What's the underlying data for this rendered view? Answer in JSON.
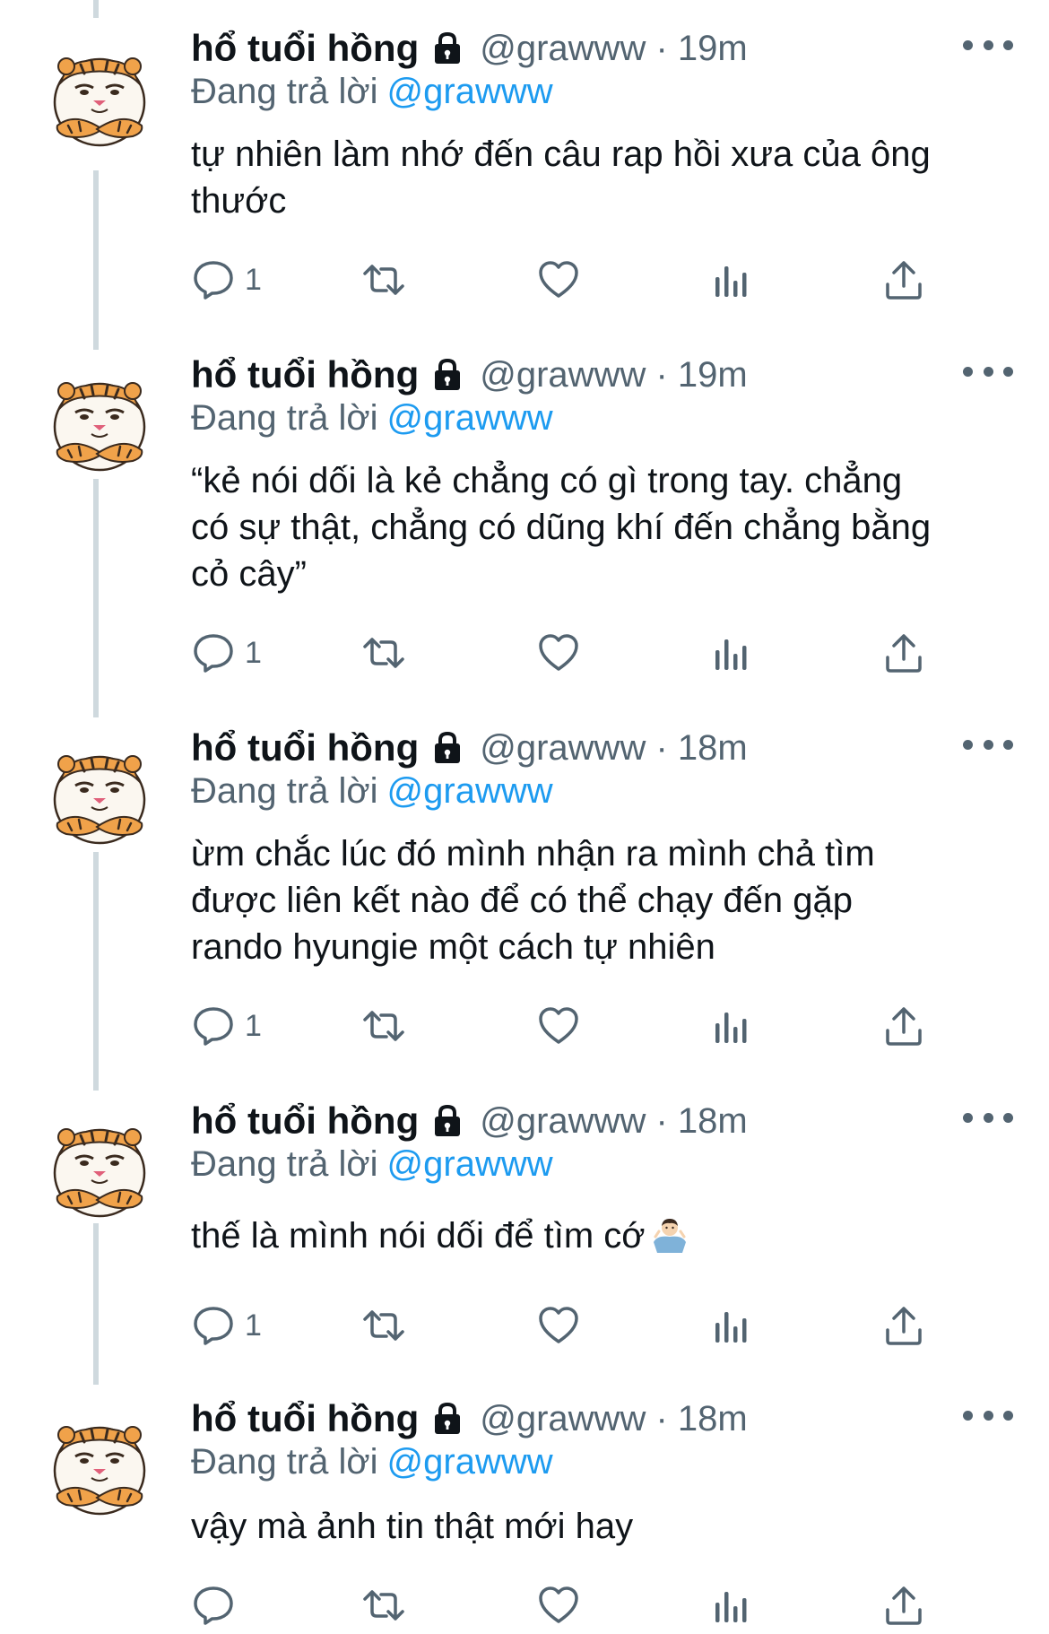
{
  "tweets": [
    {
      "name": "hổ tuổi hồng",
      "handle": "@grawww",
      "time": "19m",
      "meta": "@grawww · 19m",
      "replying_label": "Đang trả lời",
      "replying_to": "@grawww",
      "lines": [
        "tự nhiên làm nhớ đến câu rap hồi xưa của ông",
        "thước"
      ],
      "reply_count": "1"
    },
    {
      "name": "hổ tuổi hồng",
      "handle": "@grawww",
      "time": "19m",
      "meta": "@grawww · 19m",
      "replying_label": "Đang trả lời",
      "replying_to": "@grawww",
      "lines": [
        "“kẻ nói dối là kẻ chẳng có gì trong tay. chẳng",
        "có sự thật, chẳng có dũng khí đến chẳng bằng",
        "cỏ cây”"
      ],
      "reply_count": "1"
    },
    {
      "name": "hổ tuổi hồng",
      "handle": "@grawww",
      "time": "18m",
      "meta": "@grawww · 18m",
      "replying_label": "Đang trả lời",
      "replying_to": "@grawww",
      "lines": [
        "ừm chắc lúc đó mình nhận ra mình chả tìm",
        "được liên kết nào để có thể chạy đến gặp",
        "rando hyungie một cách tự nhiên"
      ],
      "reply_count": "1"
    },
    {
      "name": "hổ tuổi hồng",
      "handle": "@grawww",
      "time": "18m",
      "meta": "@grawww · 18m",
      "replying_label": "Đang trả lời",
      "replying_to": "@grawww",
      "lines": [
        "thế là mình nói dối để tìm cớ"
      ],
      "emoji": "person-shrugging-emoji",
      "reply_count": "1"
    },
    {
      "name": "hổ tuổi hồng",
      "handle": "@grawww",
      "time": "18m",
      "meta": "@grawww · 18m",
      "replying_label": "Đang trả lời",
      "replying_to": "@grawww",
      "lines": [
        "vậy mà ảnh tin thật mới hay"
      ],
      "reply_count": ""
    }
  ],
  "icons": {
    "avatar": "tiger-avatar",
    "protected": "lock-icon",
    "more": "more-options-icon",
    "reply": "reply-icon",
    "retweet": "retweet-icon",
    "like": "heart-icon",
    "views": "analytics-icon",
    "share": "share-icon"
  },
  "colors": {
    "text": "#0f1419",
    "secondary": "#536471",
    "accent": "#1d9bf0",
    "thread_line": "#cfd9de"
  }
}
